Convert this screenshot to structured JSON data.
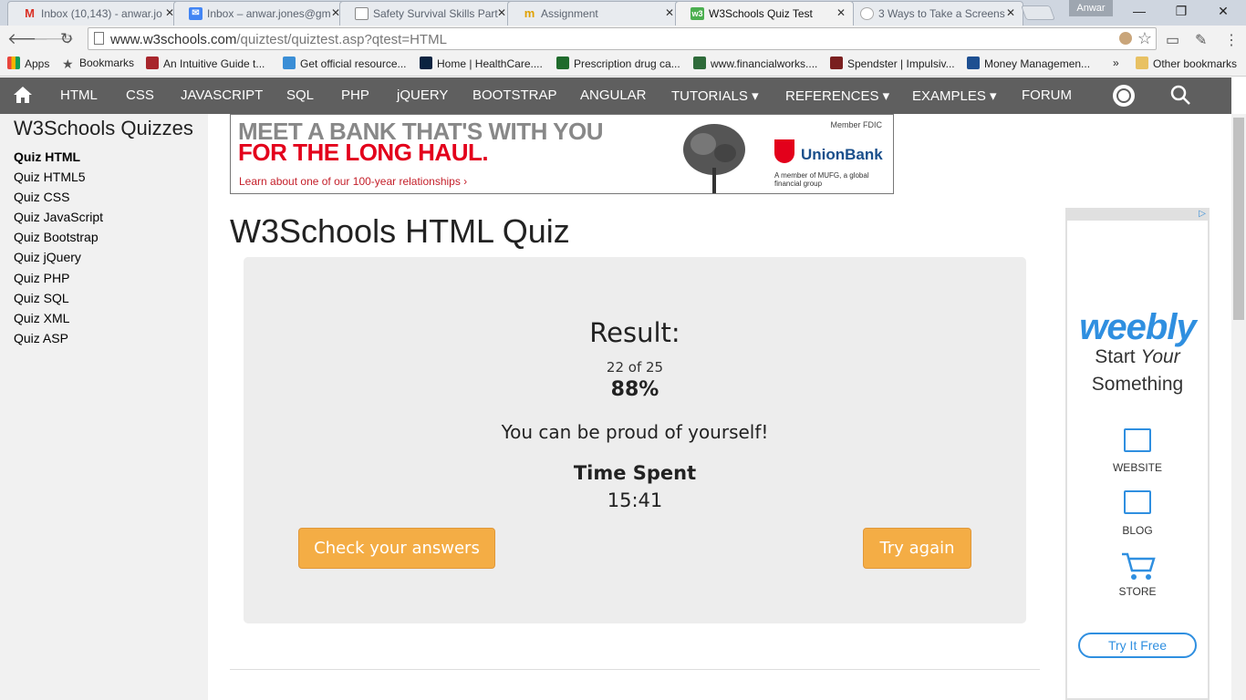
{
  "browser": {
    "tabs": [
      {
        "title": "Inbox (10,143) - anwar.jo",
        "fav": "M",
        "favcolor": "#d93025"
      },
      {
        "title": "Inbox – anwar.jones@gm",
        "fav": "✉",
        "favcolor": "#4285f4"
      },
      {
        "title": "Safety Survival Skills Part",
        "fav": "",
        "favcolor": "#ffffff"
      },
      {
        "title": "Assignment",
        "fav": "m",
        "favcolor": "#e0a100"
      },
      {
        "title": "W3Schools Quiz Test",
        "fav": "w3",
        "favcolor": "#4caf50"
      },
      {
        "title": "3 Ways to Take a Screens",
        "fav": "",
        "favcolor": "#ffffff"
      }
    ],
    "profile": "Anwar",
    "url_domain": "www.w3schools.com",
    "url_path": "/quiztest/quiztest.asp?qtest=HTML",
    "bookmarks": [
      {
        "label": "Apps",
        "color": "#e8453c"
      },
      {
        "label": "Bookmarks",
        "color": "#555555"
      },
      {
        "label": "An Intuitive Guide t...",
        "color": "#a8262c"
      },
      {
        "label": "Get official resource...",
        "color": "#3a8ed6"
      },
      {
        "label": "Home | HealthCare....",
        "color": "#0b2340"
      },
      {
        "label": "Prescription drug ca...",
        "color": "#1f6b2c"
      },
      {
        "label": "www.financialworks....",
        "color": "#2e6b3a"
      },
      {
        "label": "Spendster | Impulsiv...",
        "color": "#7a1f1f"
      },
      {
        "label": "Money Managemen...",
        "color": "#1d4f91"
      }
    ],
    "bookmarks_more": "»",
    "other_bookmarks": "Other bookmarks"
  },
  "w3nav": {
    "items": [
      "HTML",
      "CSS",
      "JAVASCRIPT",
      "SQL",
      "PHP",
      "jQUERY",
      "BOOTSTRAP",
      "ANGULAR",
      "TUTORIALS ▾",
      "REFERENCES ▾",
      "EXAMPLES ▾",
      "FORUM"
    ]
  },
  "sidebar": {
    "title": "W3Schools Quizzes",
    "links": [
      "Quiz HTML",
      "Quiz HTML5",
      "Quiz CSS",
      "Quiz JavaScript",
      "Quiz Bootstrap",
      "Quiz jQuery",
      "Quiz PHP",
      "Quiz SQL",
      "Quiz XML",
      "Quiz ASP"
    ]
  },
  "banner": {
    "line1": "MEET A BANK THAT'S WITH YOU",
    "line2": "FOR THE LONG HAUL.",
    "line3": "Learn about one of our 100-year relationships ›",
    "fdic": "Member FDIC",
    "bank": "UnionBank",
    "mufg": "A member of MUFG, a global financial group"
  },
  "main": {
    "title": "W3Schools HTML Quiz",
    "result_heading": "Result:",
    "score": "22 of 25",
    "percent": "88%",
    "message": "You can be proud of yourself!",
    "time_heading": "Time Spent",
    "time": "15:41",
    "check_button": "Check your answers",
    "try_button": "Try again"
  },
  "sidead": {
    "adchoice": "▷",
    "brand": "weebly",
    "start": "Start",
    "your": "Your",
    "something": "Something",
    "features": [
      "WEBSITE",
      "BLOG",
      "STORE"
    ],
    "cta": "Try It Free"
  }
}
